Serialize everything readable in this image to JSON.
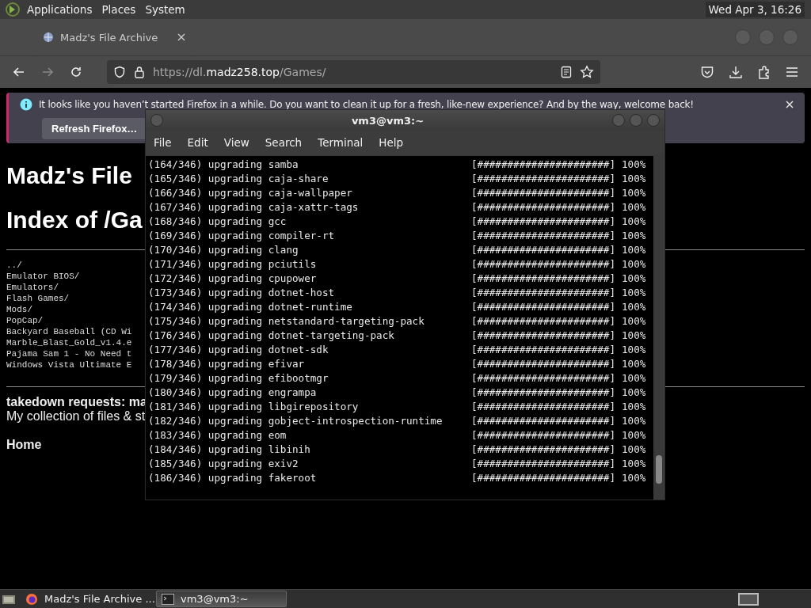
{
  "top_panel": {
    "menus": [
      "Applications",
      "Places",
      "System"
    ],
    "clock": "Wed Apr  3, 16:26"
  },
  "browser": {
    "tabs": [
      {
        "title": "Madz's File Archive",
        "selected": true
      }
    ],
    "url": {
      "scheme": "https://dl.",
      "domain": "madz258.top",
      "path": "/Games/"
    },
    "notification": {
      "message": "It looks like you haven’t started Firefox in a while. Do you want to clean it up for a fresh, like-new experience? And by the way, welcome back!",
      "button": "Refresh Firefox…"
    },
    "page": {
      "title": "Madz's File",
      "heading": "Index of /Ga",
      "entries": [
        "../",
        "Emulator BIOS/",
        "Emulators/",
        "Flash Games/",
        "Mods/",
        "PopCap/",
        "Backyard Baseball (CD Wi",
        "Marble_Blast_Gold_v1.4.e",
        "Pajama Sam 1 - No Need t",
        "Windows Vista Ultimate E"
      ],
      "takedown": "takedown requests: ma",
      "description": "My collection of files & st",
      "home": "Home"
    }
  },
  "terminal": {
    "title": "vm3@vm3:~",
    "menus": [
      "File",
      "Edit",
      "View",
      "Search",
      "Terminal",
      "Help"
    ],
    "lines": [
      {
        "text": "(164/346) upgrading samba",
        "bar": "[######################]",
        "percent": "100%"
      },
      {
        "text": "(165/346) upgrading caja-share",
        "bar": "[######################]",
        "percent": "100%"
      },
      {
        "text": "(166/346) upgrading caja-wallpaper",
        "bar": "[######################]",
        "percent": "100%"
      },
      {
        "text": "(167/346) upgrading caja-xattr-tags",
        "bar": "[######################]",
        "percent": "100%"
      },
      {
        "text": "(168/346) upgrading gcc",
        "bar": "[######################]",
        "percent": "100%"
      },
      {
        "text": "(169/346) upgrading compiler-rt",
        "bar": "[######################]",
        "percent": "100%"
      },
      {
        "text": "(170/346) upgrading clang",
        "bar": "[######################]",
        "percent": "100%"
      },
      {
        "text": "(171/346) upgrading pciutils",
        "bar": "[######################]",
        "percent": "100%"
      },
      {
        "text": "(172/346) upgrading cpupower",
        "bar": "[######################]",
        "percent": "100%"
      },
      {
        "text": "(173/346) upgrading dotnet-host",
        "bar": "[######################]",
        "percent": "100%"
      },
      {
        "text": "(174/346) upgrading dotnet-runtime",
        "bar": "[######################]",
        "percent": "100%"
      },
      {
        "text": "(175/346) upgrading netstandard-targeting-pack",
        "bar": "[######################]",
        "percent": "100%"
      },
      {
        "text": "(176/346) upgrading dotnet-targeting-pack",
        "bar": "[######################]",
        "percent": "100%"
      },
      {
        "text": "(177/346) upgrading dotnet-sdk",
        "bar": "[######################]",
        "percent": "100%"
      },
      {
        "text": "(178/346) upgrading efivar",
        "bar": "[######################]",
        "percent": "100%"
      },
      {
        "text": "(179/346) upgrading efibootmgr",
        "bar": "[######################]",
        "percent": "100%"
      },
      {
        "text": "(180/346) upgrading engrampa",
        "bar": "[######################]",
        "percent": "100%"
      },
      {
        "text": "(181/346) upgrading libgirepository",
        "bar": "[######################]",
        "percent": "100%"
      },
      {
        "text": "(182/346) upgrading gobject-introspection-runtime",
        "bar": "[######################]",
        "percent": "100%"
      },
      {
        "text": "(183/346) upgrading eom",
        "bar": "[######################]",
        "percent": "100%"
      },
      {
        "text": "(184/346) upgrading libinih",
        "bar": "[######################]",
        "percent": "100%"
      },
      {
        "text": "(185/346) upgrading exiv2",
        "bar": "[######################]",
        "percent": "100%"
      },
      {
        "text": "(186/346) upgrading fakeroot",
        "bar": "[######################]",
        "percent": "100%"
      }
    ]
  },
  "taskbar": {
    "items": [
      {
        "kind": "browser",
        "label": "Madz's File Archive ...",
        "selected": false
      },
      {
        "kind": "terminal",
        "label": "vm3@vm3:~",
        "selected": true
      }
    ]
  }
}
